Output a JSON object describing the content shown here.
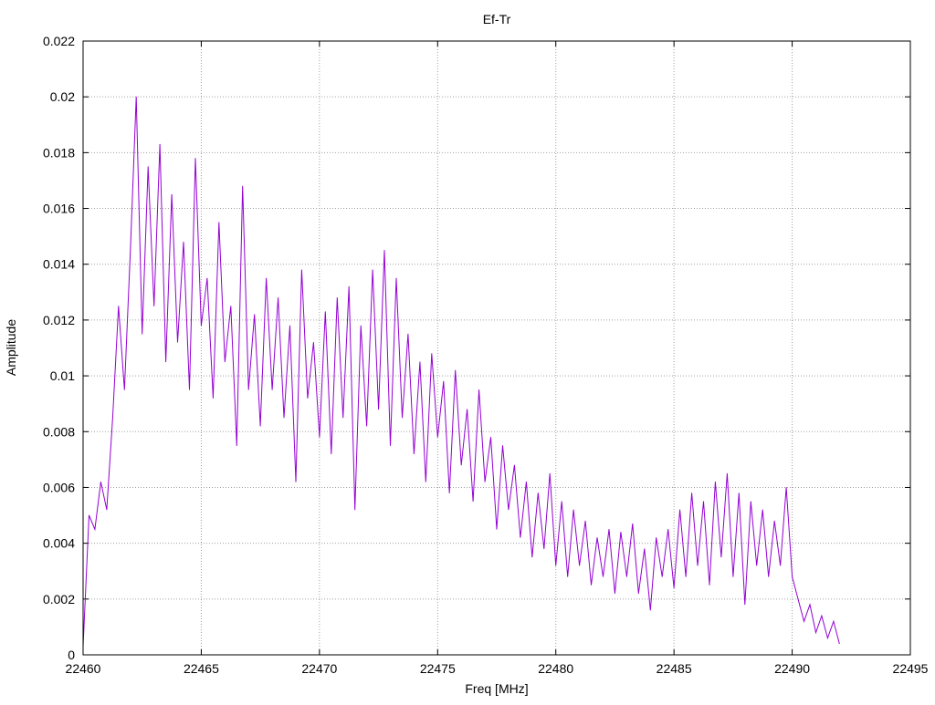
{
  "chart_data": {
    "type": "line",
    "title": "Ef-Tr",
    "xlabel": "Freq [MHz]",
    "ylabel": "Amplitude",
    "xlim": [
      22460,
      22495
    ],
    "ylim": [
      0,
      0.022
    ],
    "grid": true,
    "x_ticks": [
      "22460",
      "22465",
      "22470",
      "22475",
      "22480",
      "22485",
      "22490",
      "22495"
    ],
    "y_ticks": [
      "0",
      "0.002",
      "0.004",
      "0.006",
      "0.008",
      "0.01",
      "0.012",
      "0.014",
      "0.016",
      "0.018",
      "0.02",
      "0.022"
    ],
    "series": [
      {
        "name": "Ef-Tr",
        "color": "#9400d3",
        "x_start": 22460,
        "x_step": 0.25,
        "values": [
          0.0003,
          0.005,
          0.0045,
          0.0062,
          0.0052,
          0.0085,
          0.0125,
          0.0095,
          0.0145,
          0.02,
          0.0115,
          0.0175,
          0.0125,
          0.0183,
          0.0105,
          0.0165,
          0.0112,
          0.0148,
          0.0095,
          0.0178,
          0.0118,
          0.0135,
          0.0092,
          0.0155,
          0.0105,
          0.0125,
          0.0075,
          0.0168,
          0.0095,
          0.0122,
          0.0082,
          0.0135,
          0.0095,
          0.0128,
          0.0085,
          0.0118,
          0.0062,
          0.0138,
          0.0092,
          0.0112,
          0.0078,
          0.0123,
          0.0072,
          0.0128,
          0.0085,
          0.0132,
          0.0052,
          0.0118,
          0.0082,
          0.0138,
          0.0088,
          0.0145,
          0.0075,
          0.0135,
          0.0085,
          0.0115,
          0.0072,
          0.0105,
          0.0062,
          0.0108,
          0.0078,
          0.0098,
          0.0058,
          0.0102,
          0.0068,
          0.0088,
          0.0055,
          0.0095,
          0.0062,
          0.0078,
          0.0045,
          0.0075,
          0.0052,
          0.0068,
          0.0042,
          0.0062,
          0.0035,
          0.0058,
          0.0038,
          0.0065,
          0.0032,
          0.0055,
          0.0028,
          0.0052,
          0.0032,
          0.0048,
          0.0025,
          0.0042,
          0.0028,
          0.0045,
          0.0022,
          0.0044,
          0.0028,
          0.0047,
          0.0022,
          0.0038,
          0.0016,
          0.0042,
          0.0028,
          0.0045,
          0.0024,
          0.0052,
          0.0028,
          0.0058,
          0.0032,
          0.0055,
          0.0025,
          0.0062,
          0.0035,
          0.0065,
          0.0028,
          0.0058,
          0.0018,
          0.0055,
          0.0032,
          0.0052,
          0.0028,
          0.0048,
          0.0032,
          0.006,
          0.0028,
          0.002,
          0.0012,
          0.0018,
          0.0008,
          0.0014,
          0.0006,
          0.0012,
          0.0004
        ]
      }
    ]
  }
}
